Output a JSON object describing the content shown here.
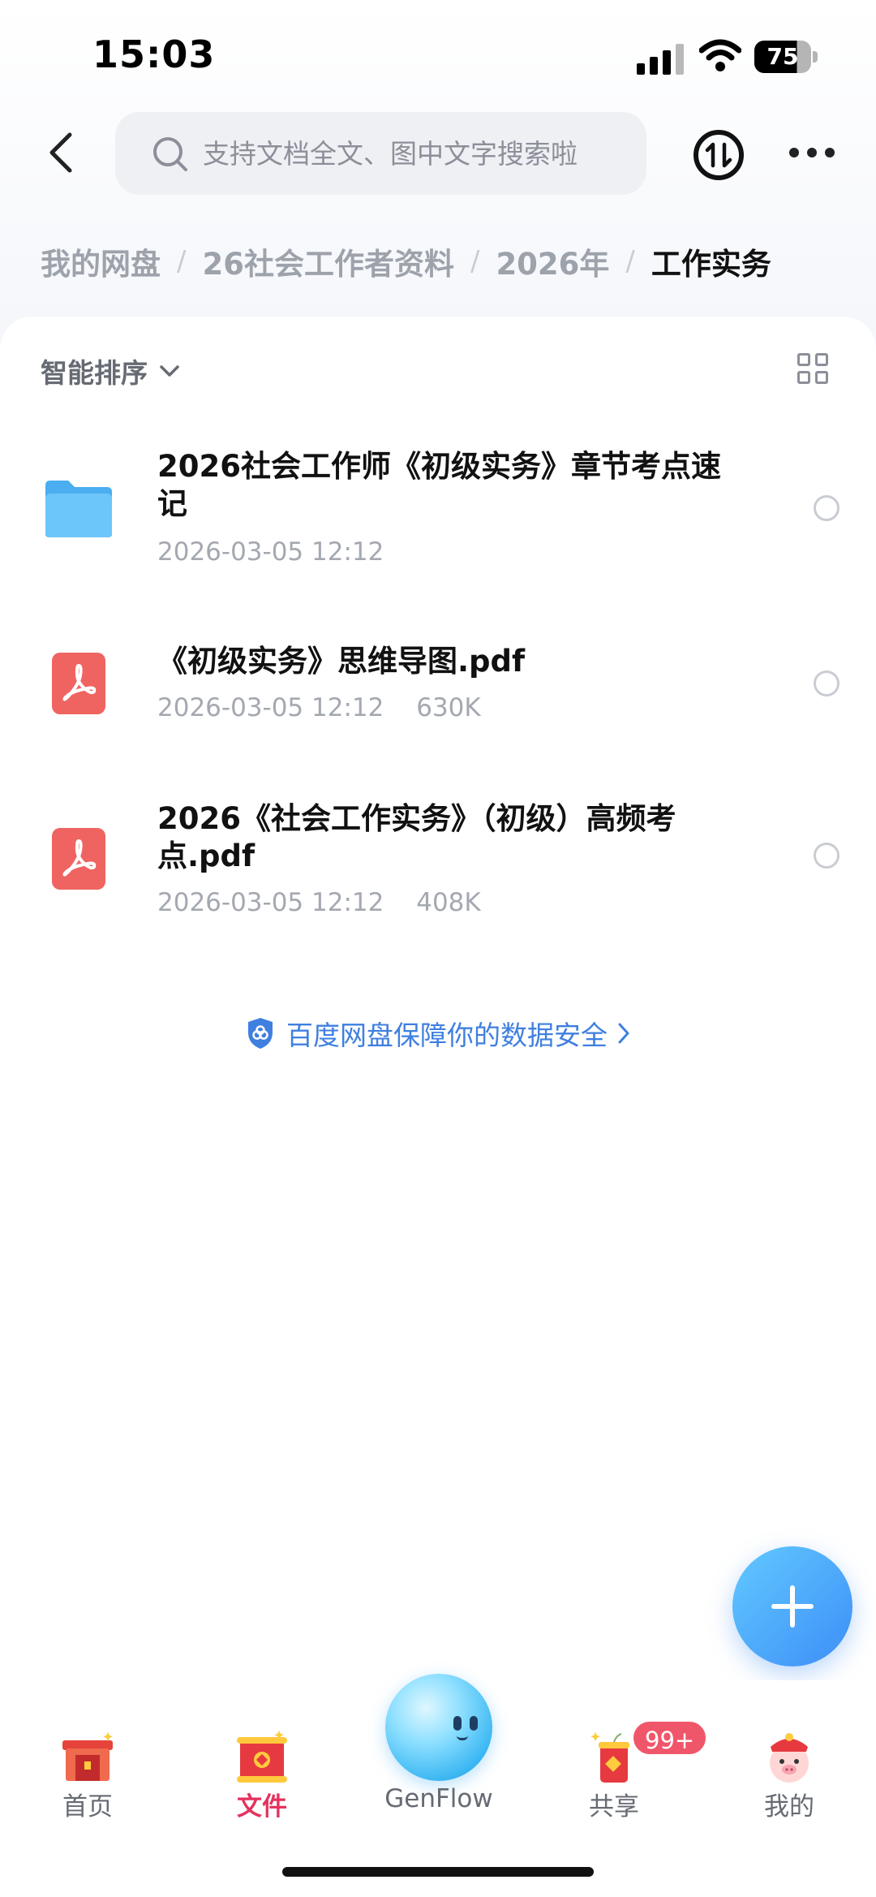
{
  "status_bar": {
    "time": "15:03",
    "battery": "75"
  },
  "header": {
    "search_placeholder": "支持文档全文、图中文字搜索啦"
  },
  "breadcrumb": [
    {
      "label": "我的网盘"
    },
    {
      "label": "26社会工作者资料"
    },
    {
      "label": "2026年"
    },
    {
      "label": "工作实务"
    }
  ],
  "toolbar": {
    "sort_label": "智能排序"
  },
  "files": [
    {
      "type": "folder",
      "name": "2026社会工作师《初级实务》章节考点速记",
      "date": "2026-03-05 12:12",
      "size": ""
    },
    {
      "type": "pdf",
      "name": "《初级实务》思维导图.pdf",
      "date": "2026-03-05 12:12",
      "size": "630K"
    },
    {
      "type": "pdf",
      "name": "2026《社会工作实务》（初级）高频考点.pdf",
      "date": "2026-03-05 12:12",
      "size": "408K"
    }
  ],
  "security_notice": "百度网盘保障你的数据安全",
  "tabs": [
    {
      "label": "首页"
    },
    {
      "label": "文件"
    },
    {
      "label": "GenFlow"
    },
    {
      "label": "共享",
      "badge": "99+"
    },
    {
      "label": "我的"
    }
  ],
  "colors": {
    "accent": "#e5325e",
    "link": "#3f7fe0",
    "fab": "#3d8ef7",
    "pdf": "#ef6461",
    "folder": "#5bbcf5"
  }
}
